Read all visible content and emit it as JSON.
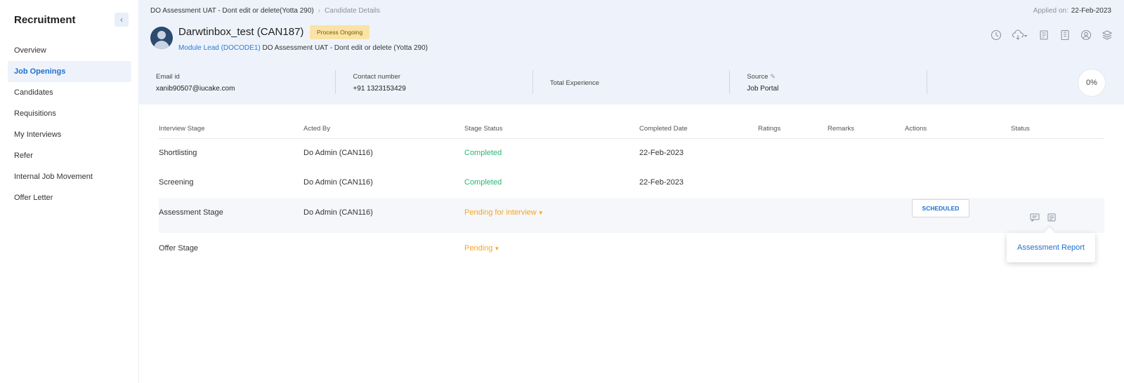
{
  "sidebar": {
    "title": "Recruitment",
    "items": [
      {
        "label": "Overview"
      },
      {
        "label": "Job Openings"
      },
      {
        "label": "Candidates"
      },
      {
        "label": "Requisitions"
      },
      {
        "label": "My Interviews"
      },
      {
        "label": "Refer"
      },
      {
        "label": "Internal Job Movement"
      },
      {
        "label": "Offer Letter"
      }
    ],
    "active_index": 1
  },
  "header": {
    "breadcrumb": {
      "parent": "DO Assessment UAT - Dont edit or delete(Yotta 290)",
      "current": "Candidate Details"
    },
    "applied_label": "Applied on:",
    "applied_date": "22-Feb-2023",
    "candidate_name": "Darwtinbox_test (CAN187)",
    "status_badge": "Process Ongoing",
    "role_link": "Module Lead (DOCODE1)",
    "role_rest": " DO Assessment UAT - Dont edit or delete (Yotta 290)",
    "toolbar_icons": [
      "history-icon",
      "cloud-download-icon",
      "document-icon",
      "file-icon",
      "user-circle-icon",
      "layers-icon"
    ]
  },
  "info": {
    "email_label": "Email id",
    "email": "xanib90507@iucake.com",
    "contact_label": "Contact number",
    "contact": "+91 1323153429",
    "experience_label": "Total Experience",
    "source_label": "Source",
    "source": "Job Portal",
    "progress": "0%"
  },
  "table": {
    "headers": [
      "Interview Stage",
      "Acted By",
      "Stage Status",
      "Completed Date",
      "Ratings",
      "Remarks",
      "Actions",
      "Status"
    ],
    "rows": [
      {
        "stage": "Shortlisting",
        "acted_by": "Do Admin (CAN116)",
        "status": "Completed",
        "date": "22-Feb-2023"
      },
      {
        "stage": "Screening",
        "acted_by": "Do Admin (CAN116)",
        "status": "Completed",
        "date": "22-Feb-2023"
      },
      {
        "stage": "Assessment Stage",
        "acted_by": "Do Admin (CAN116)",
        "status": "Pending for interview",
        "action": "SCHEDULED"
      },
      {
        "stage": "Offer Stage",
        "acted_by": "",
        "status": "Pending"
      }
    ]
  },
  "popup": {
    "label": "Assessment Report"
  },
  "colors": {
    "accent": "#1f6fd0",
    "completed": "#2bb673",
    "pending": "#f5a623",
    "header_bg": "#eef3fb",
    "badge_bg": "#fbe3a7"
  }
}
